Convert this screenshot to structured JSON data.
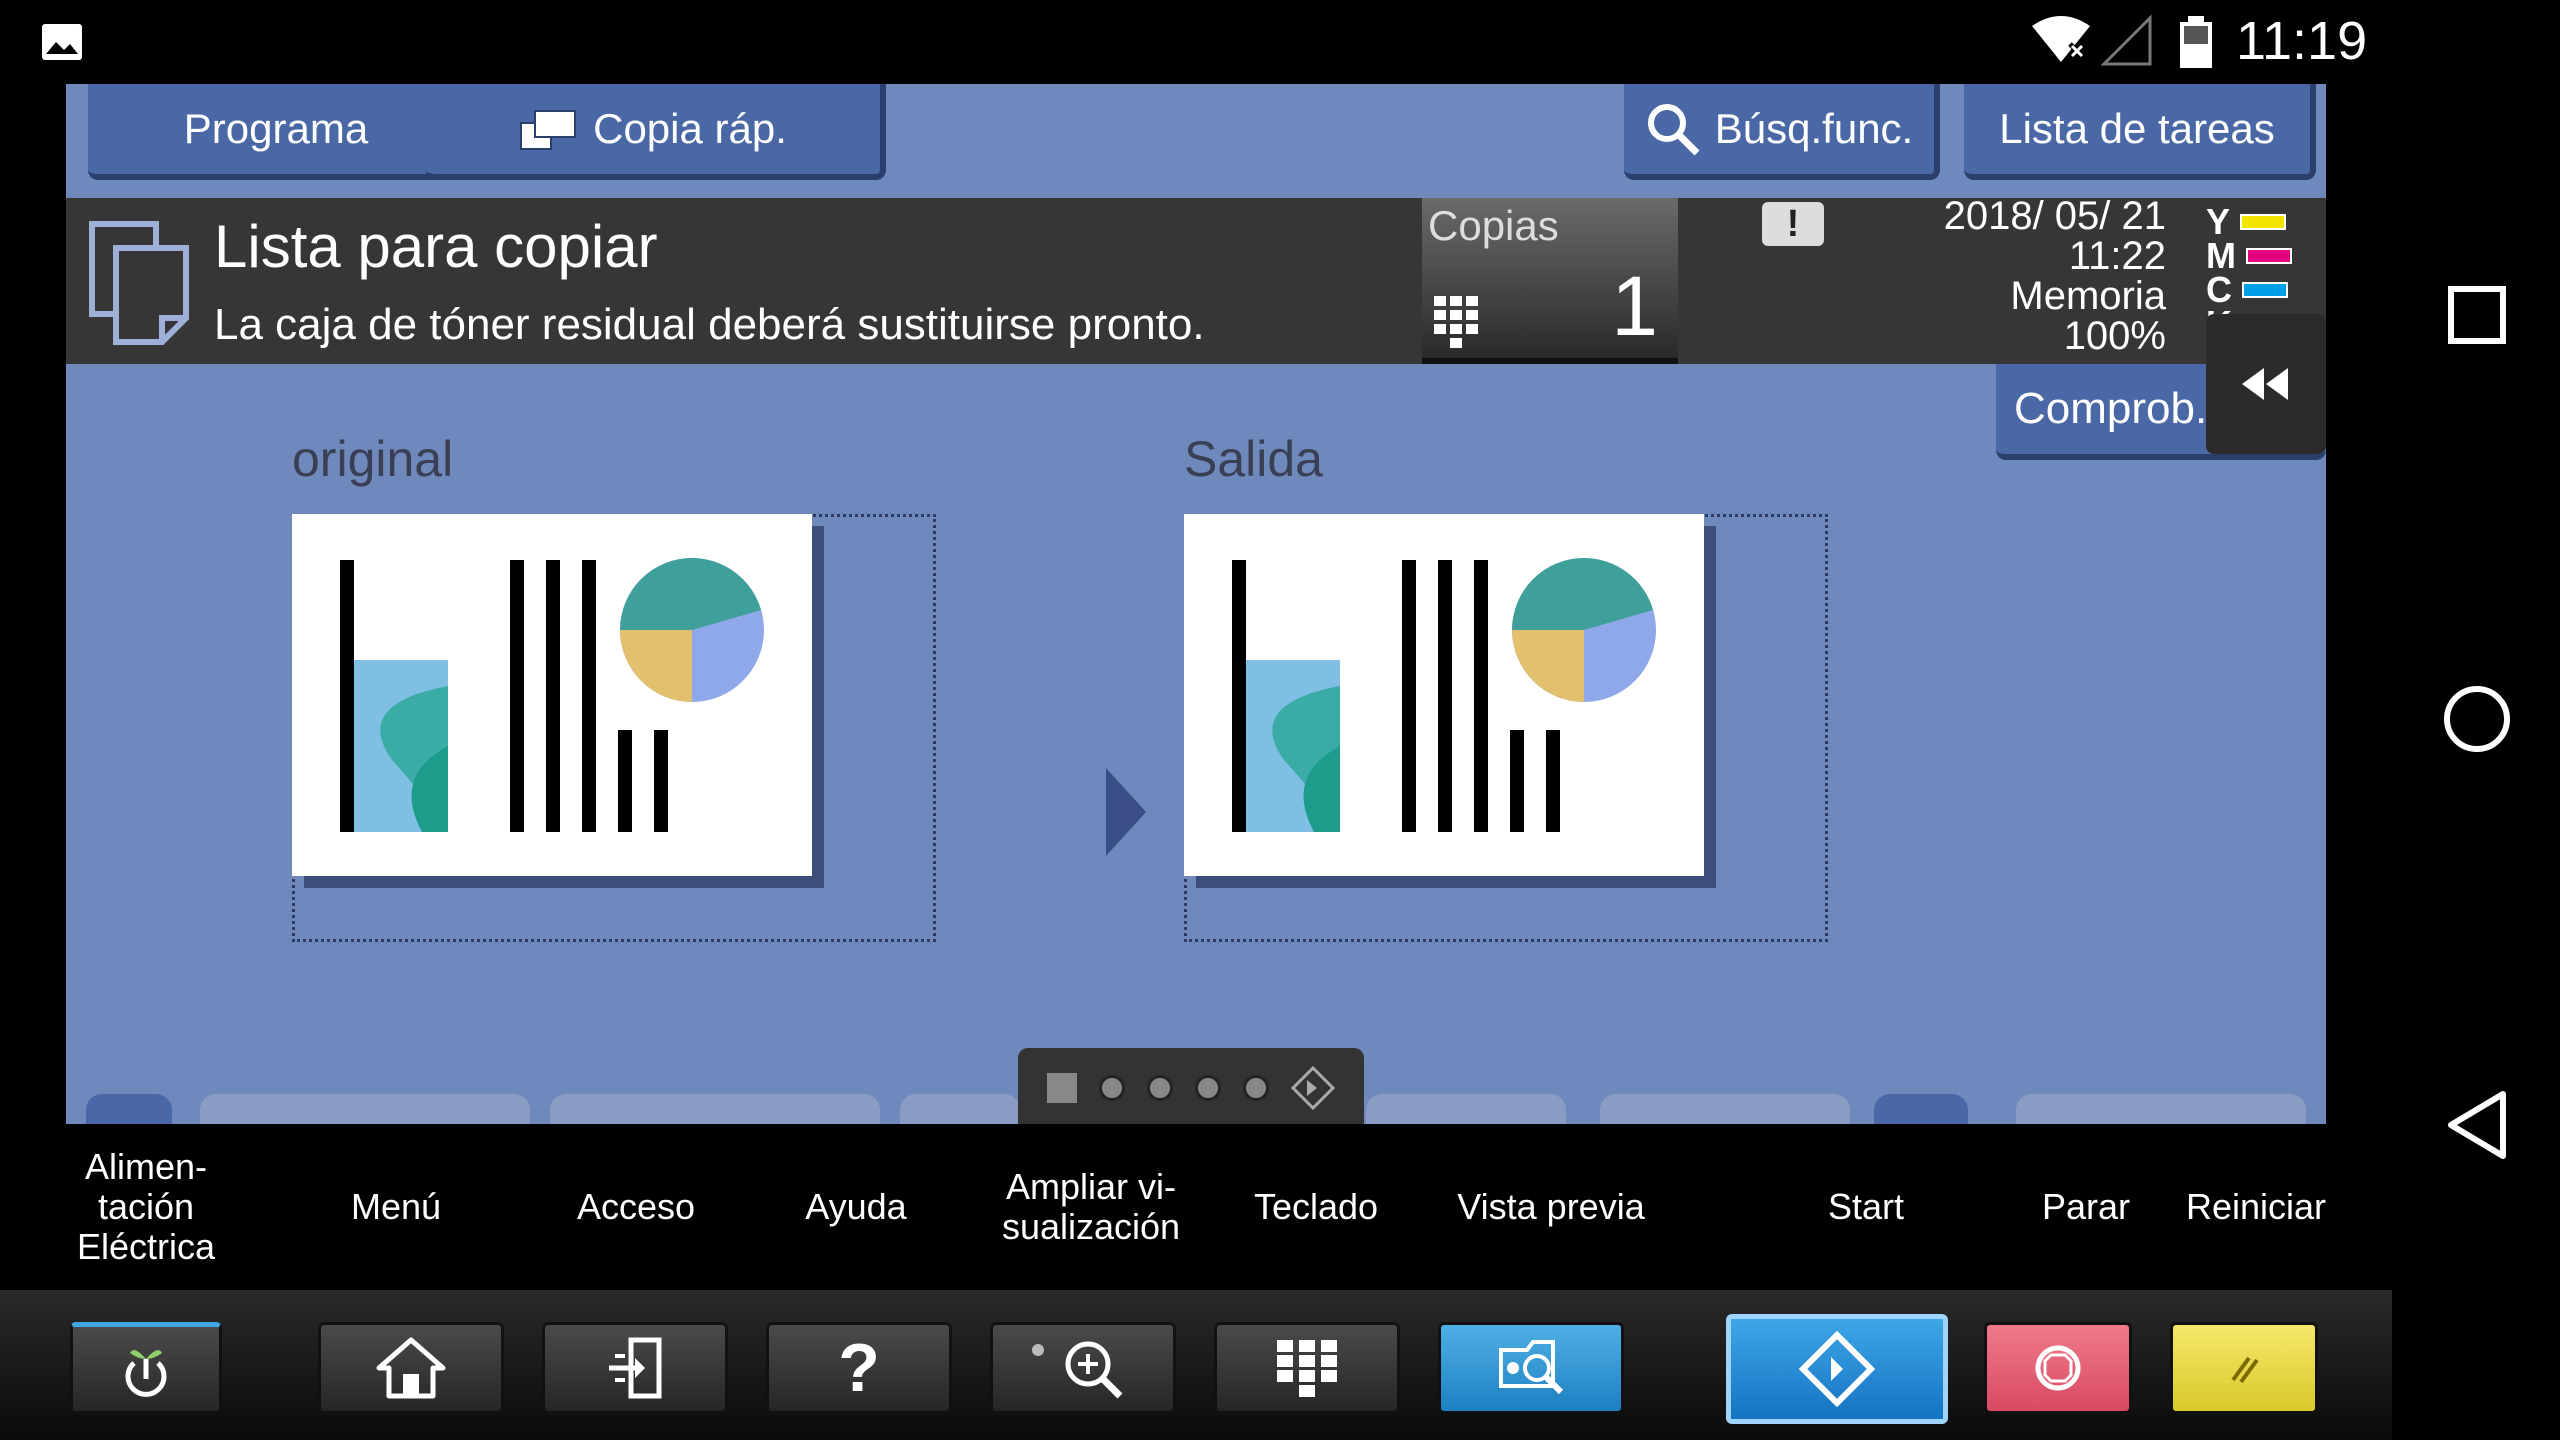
{
  "status_bar": {
    "time": "11:19",
    "icons": [
      "image-notification-icon",
      "wifi-icon",
      "signal-icon",
      "battery-icon"
    ]
  },
  "top_tabs": {
    "programa": "Programa",
    "copia_rap": "Copia ráp.",
    "busq_func": "Búsq.func.",
    "lista_tareas": "Lista de tareas"
  },
  "status": {
    "title": "Lista para copiar",
    "message": "La caja de tóner residual deberá sustituirse pronto."
  },
  "copies": {
    "label": "Copias",
    "value": "1"
  },
  "info": {
    "date": "2018/ 05/ 21",
    "time": "11:22",
    "memory_label": "Memoria",
    "memory_value": "100%",
    "comprob_label": "Comprob. config."
  },
  "toner": [
    {
      "label": "Y",
      "color": "#f2e600"
    },
    {
      "label": "M",
      "color": "#e6007e"
    },
    {
      "label": "C",
      "color": "#00a0e9"
    },
    {
      "label": "K",
      "color": "#000000"
    }
  ],
  "preview": {
    "original_label": "original",
    "output_label": "Salida"
  },
  "bottom_labels": {
    "power": "Alimen-\ntación\nEléctrica",
    "menu": "Menú",
    "access": "Acceso",
    "help": "Ayuda",
    "zoom": "Ampliar vi-\nsualización",
    "keypad": "Teclado",
    "preview": "Vista previa",
    "start": "Start",
    "stop": "Parar",
    "reset": "Reiniciar"
  },
  "colors": {
    "panel_blue": "#6f89bd",
    "button_blue": "#4a68a6",
    "status_dark": "#363636",
    "start_blue": "#1e8ad6",
    "stop_red": "#e05a70",
    "reset_yellow": "#e8dc44"
  }
}
